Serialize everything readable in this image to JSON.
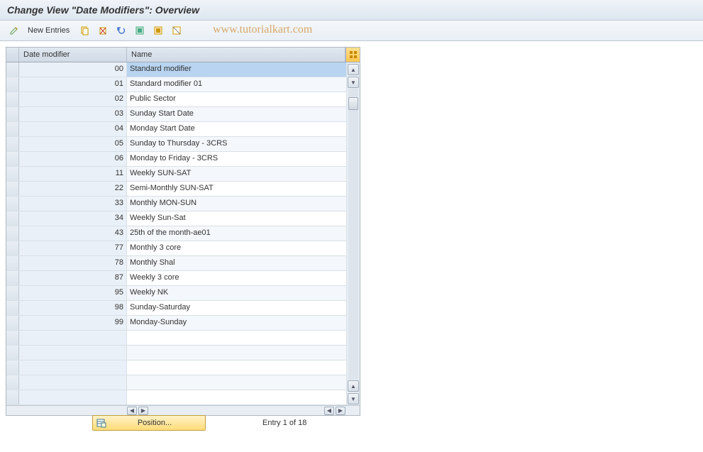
{
  "title": "Change View \"Date Modifiers\": Overview",
  "toolbar": {
    "new_entries_label": "New Entries"
  },
  "watermark": "www.tutorialkart.com",
  "table": {
    "headers": {
      "code": "Date modifier",
      "name": "Name"
    },
    "rows": [
      {
        "code": "00",
        "name": "Standard modifier",
        "selected": true
      },
      {
        "code": "01",
        "name": "Standard modifier 01"
      },
      {
        "code": "02",
        "name": "Public Sector"
      },
      {
        "code": "03",
        "name": "Sunday Start Date"
      },
      {
        "code": "04",
        "name": "Monday Start Date"
      },
      {
        "code": "05",
        "name": "Sunday to Thursday - 3CRS"
      },
      {
        "code": "06",
        "name": "Monday to Friday - 3CRS"
      },
      {
        "code": "11",
        "name": "Weekly SUN-SAT"
      },
      {
        "code": "22",
        "name": "Semi-Monthly SUN-SAT"
      },
      {
        "code": "33",
        "name": "Monthly MON-SUN"
      },
      {
        "code": "34",
        "name": "Weekly Sun-Sat"
      },
      {
        "code": "43",
        "name": "25th of the month-ae01"
      },
      {
        "code": "77",
        "name": "Monthly 3 core"
      },
      {
        "code": "78",
        "name": "Monthly Shal"
      },
      {
        "code": "87",
        "name": "Weekly 3 core"
      },
      {
        "code": "95",
        "name": "Weekly NK"
      },
      {
        "code": "98",
        "name": "Sunday-Saturday"
      },
      {
        "code": "99",
        "name": "Monday-Sunday"
      },
      {
        "code": "",
        "name": ""
      },
      {
        "code": "",
        "name": ""
      },
      {
        "code": "",
        "name": ""
      },
      {
        "code": "",
        "name": ""
      },
      {
        "code": "",
        "name": ""
      }
    ]
  },
  "footer": {
    "position_label": "Position...",
    "entry_status": "Entry 1 of 18"
  }
}
